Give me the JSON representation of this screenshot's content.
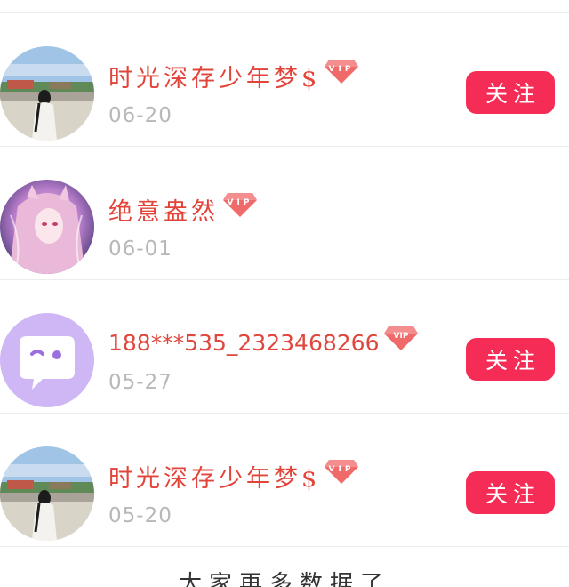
{
  "list": {
    "items": [
      {
        "avatar_icon": "beach-photo-avatar",
        "name": "时光深存少年梦$",
        "vip_label": "VIP",
        "date": "06-20",
        "follow_label": "关注",
        "show_follow": true
      },
      {
        "avatar_icon": "anime-girl-avatar",
        "name": "绝意盎然",
        "vip_label": "VIP",
        "date": "06-01",
        "follow_label": "",
        "show_follow": false
      },
      {
        "avatar_icon": "chat-bubble-avatar",
        "name": "188***535_2323468266",
        "vip_label": "VIP",
        "date": "05-27",
        "follow_label": "关注",
        "show_follow": true
      },
      {
        "avatar_icon": "beach-photo-avatar",
        "name": "时光深存少年梦$",
        "vip_label": "VIP",
        "date": "05-20",
        "follow_label": "关注",
        "show_follow": true
      }
    ]
  },
  "footer": {
    "text": "太家再多数据了"
  },
  "colors": {
    "name": "#e2443a",
    "follow_button": "#f52c55",
    "date": "#b8b8b8",
    "vip_gem": "#f06a6a"
  }
}
